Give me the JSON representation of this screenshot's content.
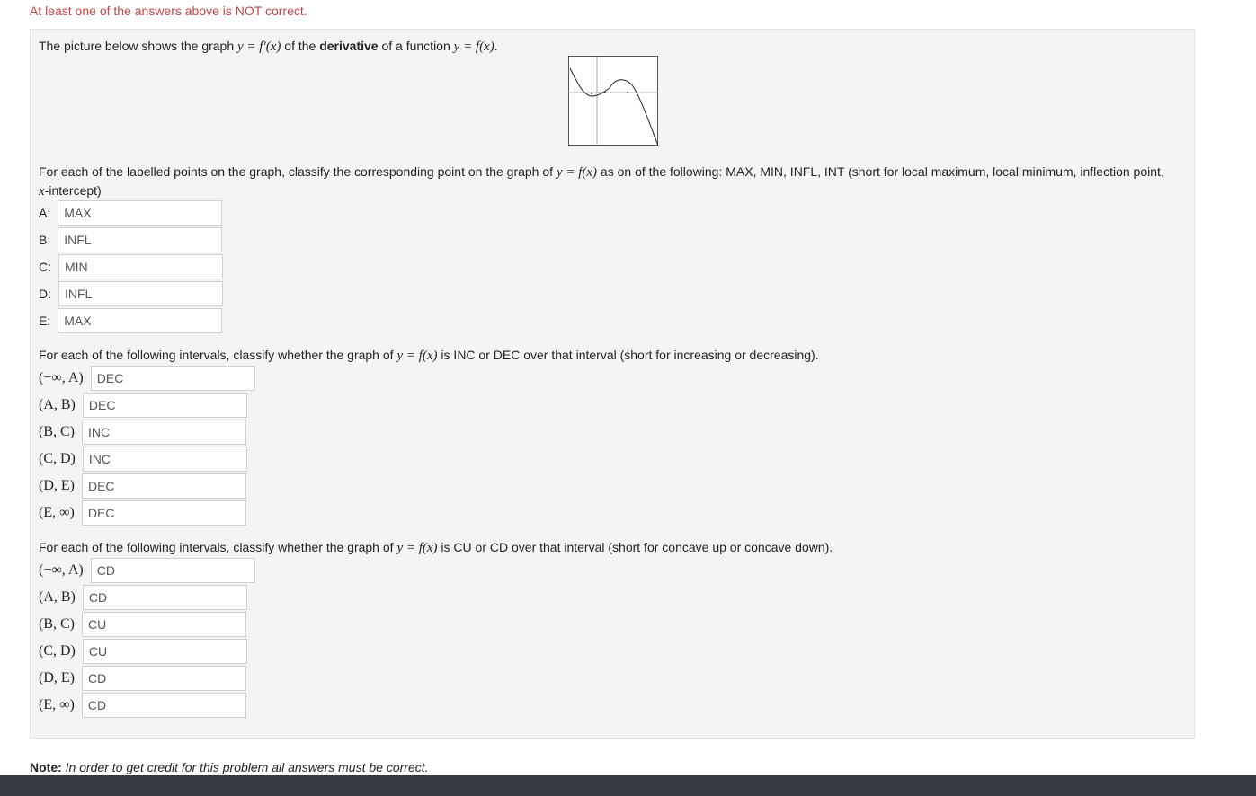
{
  "status_message": "At least one of the answers above is NOT correct.",
  "intro": {
    "t1": "The picture below shows the graph ",
    "m1": "y = f′(x)",
    "t2": " of the ",
    "bold": "derivative",
    "t3": " of a function ",
    "m2": "y = f(x)",
    "t4": "."
  },
  "q1": {
    "t1": "For each of the labelled points on the graph, classify the corresponding point on the graph of ",
    "m1": "y = f(x)",
    "t2": " as on of the following: MAX, MIN, INFL, INT (short for local maximum, local minimum, inflection point,",
    "m2": "x",
    "t3": "-intercept)",
    "points": [
      {
        "label": "A:",
        "answer": "MAX"
      },
      {
        "label": "B:",
        "answer": "INFL"
      },
      {
        "label": "C:",
        "answer": "MIN"
      },
      {
        "label": "D:",
        "answer": "INFL"
      },
      {
        "label": "E:",
        "answer": "MAX"
      }
    ]
  },
  "q2": {
    "t1": "For each of the following intervals, classify whether the graph of ",
    "m1": "y = f(x)",
    "t2": " is INC or DEC over that interval (short for increasing or decreasing).",
    "intervals": [
      {
        "interval": "(−∞, A)",
        "answer": "DEC"
      },
      {
        "interval": "(A, B)",
        "answer": "DEC"
      },
      {
        "interval": "(B, C)",
        "answer": "INC"
      },
      {
        "interval": "(C, D)",
        "answer": "INC"
      },
      {
        "interval": "(D, E)",
        "answer": "DEC"
      },
      {
        "interval": "(E, ∞)",
        "answer": "DEC"
      }
    ]
  },
  "q3": {
    "t1": "For each of the following intervals, classify whether the graph of ",
    "m1": "y = f(x)",
    "t2": " is CU or CD over that interval (short for concave up or concave down).",
    "intervals": [
      {
        "interval": "(−∞, A)",
        "answer": "CD"
      },
      {
        "interval": "(A, B)",
        "answer": "CD"
      },
      {
        "interval": "(B, C)",
        "answer": "CU"
      },
      {
        "interval": "(C, D)",
        "answer": "CU"
      },
      {
        "interval": "(D, E)",
        "answer": "CD"
      },
      {
        "interval": "(E, ∞)",
        "answer": "CD"
      }
    ]
  },
  "note": {
    "label": "Note:",
    "text": " In order to get credit for this problem all answers must be correct."
  },
  "colors": {
    "status": "#b94a48",
    "panel": "#f4f4f4",
    "footer": "#343a40"
  }
}
